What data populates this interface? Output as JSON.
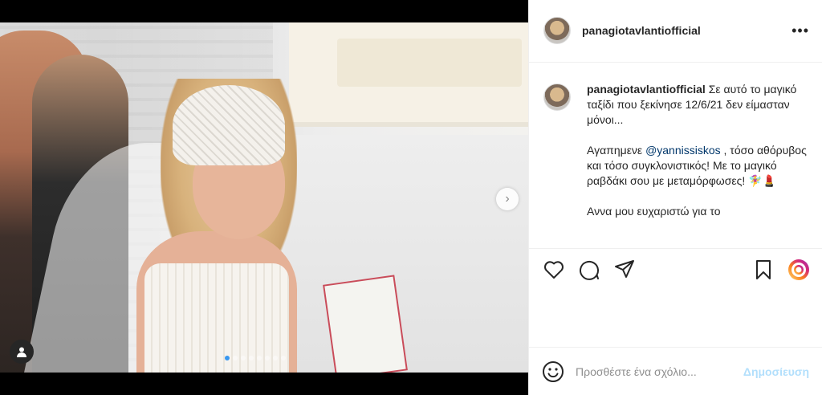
{
  "post": {
    "username": "panagiotavlantiofficial",
    "more_icon": "more-dots-icon",
    "caption_username": "panagiotavlantiofficial",
    "caption_line1": " Σε αυτό το μαγικό ταξίδι που ξεκίνησε 12/6/21 δεν είμασταν μόνοι...",
    "caption_p2_pre": "Αγαπημενε ",
    "caption_mention": "@yannissiskos",
    "caption_p2_post": " , τόσο αθόρυβος και τόσο συγκλονιστικός! Με το μαγικό ραβδάκι σου με μεταμόρφωσες! 🧚‍♀️💄",
    "caption_p3": "Αννα μου ευχαριστώ για το",
    "carousel": {
      "total": 8,
      "active": 0,
      "next_icon": "chevron-right-icon"
    },
    "actions": {
      "like": "heart-icon",
      "comment": "comment-icon",
      "share": "send-icon",
      "save": "bookmark-icon",
      "extra": "instagram-gradient-icon"
    },
    "comment": {
      "placeholder": "Προσθέστε ένα σχόλιο...",
      "post_label": "Δημοσίευση",
      "emoji_icon": "smiley-icon"
    },
    "colors": {
      "accent": "#3897f0",
      "post_disabled": "#b2dffc",
      "mention": "#00376b"
    }
  }
}
